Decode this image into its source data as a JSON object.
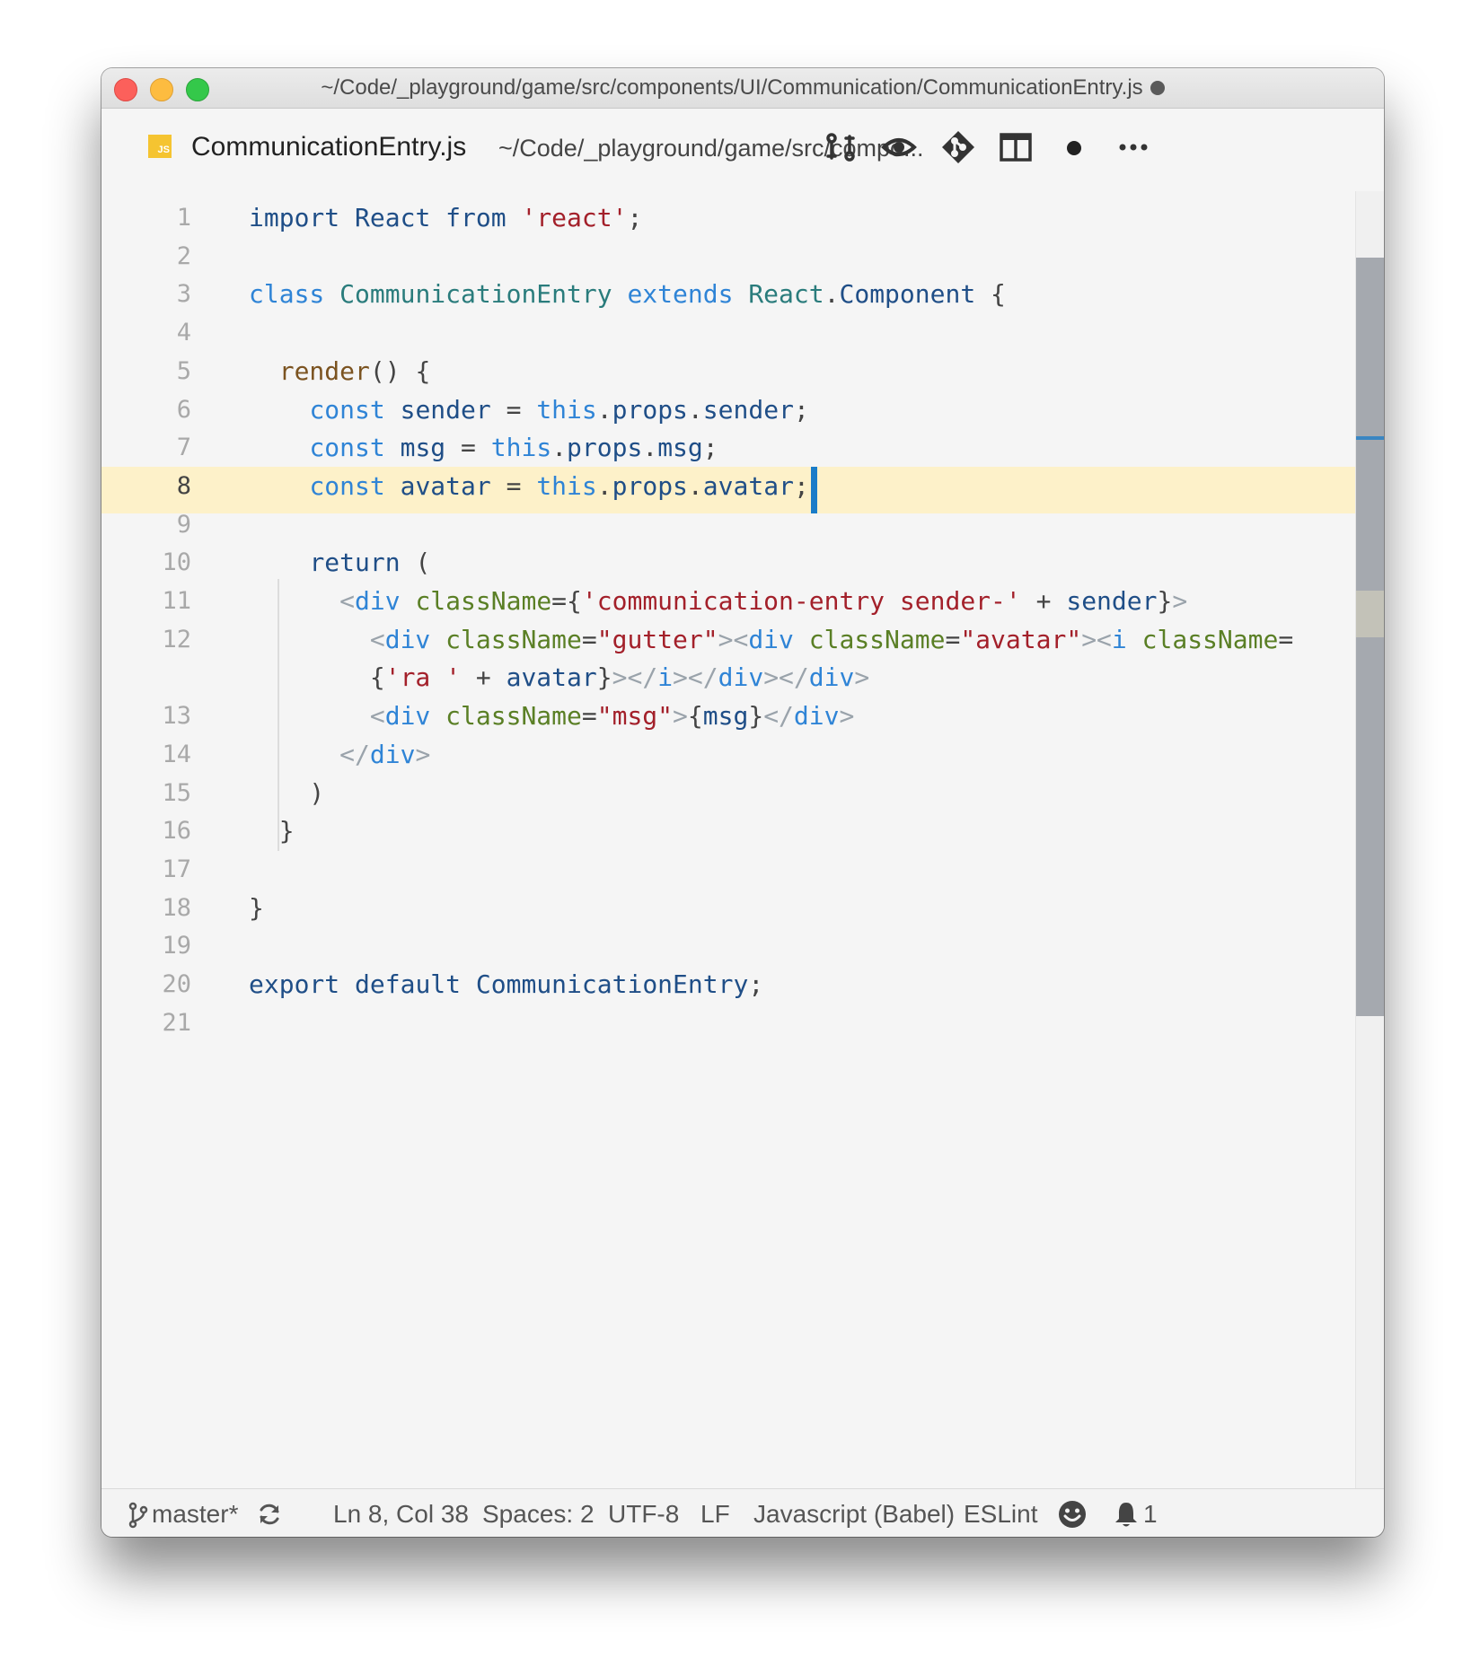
{
  "window": {
    "title": "~/Code/_playground/game/src/components/UI/Communication/CommunicationEntry.js"
  },
  "tab": {
    "icon_label": "JS",
    "file_name": "CommunicationEntry.js",
    "file_path": "~/Code/_playground/game/src/compo..."
  },
  "toolbar_icons": [
    "git-compare-icon",
    "eye-icon",
    "git-diamond-icon",
    "split-view-icon",
    "unsaved-dot-icon",
    "more-icon"
  ],
  "editor": {
    "active_line": 8,
    "line_numbers": [
      "1",
      "2",
      "3",
      "4",
      "5",
      "6",
      "7",
      "8",
      "9",
      "10",
      "11",
      "12",
      "",
      "13",
      "14",
      "15",
      "16",
      "17",
      "18",
      "19",
      "20",
      "21"
    ],
    "lines": [
      [
        [
          "k",
          "import"
        ],
        [
          "p",
          " "
        ],
        [
          "k",
          "React"
        ],
        [
          "p",
          " "
        ],
        [
          "k",
          "from"
        ],
        [
          "p",
          " "
        ],
        [
          "s",
          "'react'"
        ],
        [
          "p",
          ";"
        ]
      ],
      [],
      [
        [
          "b",
          "class"
        ],
        [
          "p",
          " "
        ],
        [
          "t",
          "CommunicationEntry"
        ],
        [
          "p",
          " "
        ],
        [
          "b",
          "extends"
        ],
        [
          "p",
          " "
        ],
        [
          "t",
          "React"
        ],
        [
          "p",
          "."
        ],
        [
          "k",
          "Component"
        ],
        [
          "p",
          " {"
        ]
      ],
      [],
      [
        [
          "p",
          "  "
        ],
        [
          "f",
          "render"
        ],
        [
          "p",
          "() {"
        ]
      ],
      [
        [
          "p",
          "    "
        ],
        [
          "b",
          "const"
        ],
        [
          "p",
          " "
        ],
        [
          "k",
          "sender"
        ],
        [
          "p",
          " = "
        ],
        [
          "b",
          "this"
        ],
        [
          "p",
          "."
        ],
        [
          "k",
          "props"
        ],
        [
          "p",
          "."
        ],
        [
          "k",
          "sender"
        ],
        [
          "p",
          ";"
        ]
      ],
      [
        [
          "p",
          "    "
        ],
        [
          "b",
          "const"
        ],
        [
          "p",
          " "
        ],
        [
          "k",
          "msg"
        ],
        [
          "p",
          " = "
        ],
        [
          "b",
          "this"
        ],
        [
          "p",
          "."
        ],
        [
          "k",
          "props"
        ],
        [
          "p",
          "."
        ],
        [
          "k",
          "msg"
        ],
        [
          "p",
          ";"
        ]
      ],
      [
        [
          "p",
          "    "
        ],
        [
          "b",
          "const"
        ],
        [
          "p",
          " "
        ],
        [
          "k",
          "avatar"
        ],
        [
          "p",
          " = "
        ],
        [
          "b",
          "this"
        ],
        [
          "p",
          "."
        ],
        [
          "k",
          "props"
        ],
        [
          "p",
          "."
        ],
        [
          "k",
          "avatar"
        ],
        [
          "p",
          ";"
        ]
      ],
      [],
      [
        [
          "p",
          "    "
        ],
        [
          "k",
          "return"
        ],
        [
          "p",
          " ("
        ]
      ],
      [
        [
          "p",
          "      "
        ],
        [
          "g",
          "<"
        ],
        [
          "b",
          "div"
        ],
        [
          "p",
          " "
        ],
        [
          "a",
          "className"
        ],
        [
          "p",
          "={"
        ],
        [
          "s",
          "'communication-entry sender-'"
        ],
        [
          "p",
          " + "
        ],
        [
          "k",
          "sender"
        ],
        [
          "p",
          "}"
        ],
        [
          "g",
          ">"
        ]
      ],
      [
        [
          "p",
          "        "
        ],
        [
          "g",
          "<"
        ],
        [
          "b",
          "div"
        ],
        [
          "p",
          " "
        ],
        [
          "a",
          "className"
        ],
        [
          "p",
          "="
        ],
        [
          "s",
          "\"gutter\""
        ],
        [
          "g",
          "><"
        ],
        [
          "b",
          "div"
        ],
        [
          "p",
          " "
        ],
        [
          "a",
          "className"
        ],
        [
          "p",
          "="
        ],
        [
          "s",
          "\"avatar\""
        ],
        [
          "g",
          "><"
        ],
        [
          "b",
          "i"
        ],
        [
          "p",
          " "
        ],
        [
          "a",
          "className"
        ],
        [
          "p",
          "="
        ]
      ],
      [
        [
          "p",
          "        {"
        ],
        [
          "s",
          "'ra '"
        ],
        [
          "p",
          " + "
        ],
        [
          "k",
          "avatar"
        ],
        [
          "p",
          "}"
        ],
        [
          "g",
          "></"
        ],
        [
          "b",
          "i"
        ],
        [
          "g",
          "></"
        ],
        [
          "b",
          "div"
        ],
        [
          "g",
          "></"
        ],
        [
          "b",
          "div"
        ],
        [
          "g",
          ">"
        ]
      ],
      [
        [
          "p",
          "        "
        ],
        [
          "g",
          "<"
        ],
        [
          "b",
          "div"
        ],
        [
          "p",
          " "
        ],
        [
          "a",
          "className"
        ],
        [
          "p",
          "="
        ],
        [
          "s",
          "\"msg\""
        ],
        [
          "g",
          ">"
        ],
        [
          "p",
          "{"
        ],
        [
          "k",
          "msg"
        ],
        [
          "p",
          "}"
        ],
        [
          "g",
          "</"
        ],
        [
          "b",
          "div"
        ],
        [
          "g",
          ">"
        ]
      ],
      [
        [
          "p",
          "      "
        ],
        [
          "g",
          "</"
        ],
        [
          "b",
          "div"
        ],
        [
          "g",
          ">"
        ]
      ],
      [
        [
          "p",
          "    )"
        ]
      ],
      [
        [
          "p",
          "  }"
        ]
      ],
      [],
      [
        [
          "p",
          "}"
        ]
      ],
      [],
      [
        [
          "k",
          "export"
        ],
        [
          "p",
          " "
        ],
        [
          "k",
          "default"
        ],
        [
          "p",
          " "
        ],
        [
          "k",
          "CommunicationEntry"
        ],
        [
          "p",
          ";"
        ]
      ],
      []
    ]
  },
  "status": {
    "branch": "master*",
    "cursor": "Ln 8, Col 38",
    "indent": "Spaces: 2",
    "encoding": "UTF-8",
    "line_ending": "LF",
    "language": "Javascript (Babel)",
    "linter": "ESLint",
    "notifications": "1"
  }
}
